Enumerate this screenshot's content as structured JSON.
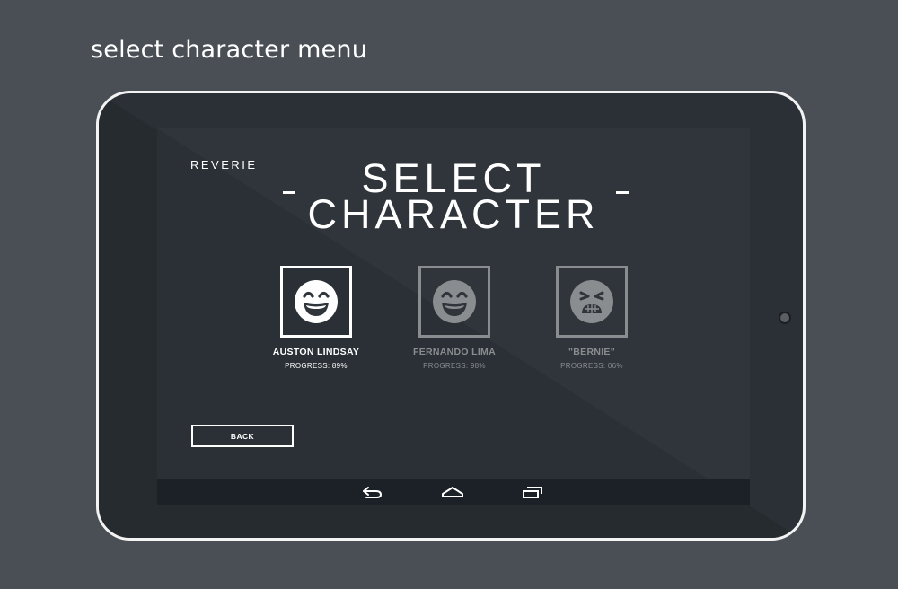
{
  "caption": "select character menu",
  "app": {
    "brand": "REVERIE",
    "title_line1": "SELECT",
    "title_line2": "CHARACTER"
  },
  "characters": [
    {
      "name": "AUSTON LINDSAY",
      "progress": "PROGRESS: 89%",
      "state": "selected",
      "icon": "grinning-face-icon"
    },
    {
      "name": "FERNANDO LIMA",
      "progress": "PROGRESS: 98%",
      "state": "inactive",
      "icon": "grinning-face-icon"
    },
    {
      "name": "\"BERNIE\"",
      "progress": "PROGRESS: 06%",
      "state": "inactive",
      "icon": "persevering-face-icon"
    }
  ],
  "back_button": {
    "label": "BACK"
  },
  "navbar": {
    "icons": [
      "back-arrow-icon",
      "home-icon",
      "recent-apps-icon"
    ]
  },
  "colors": {
    "page_background": "#4a4f55",
    "tablet_body": "#2b3036",
    "screen_background": "#2f353b",
    "navbar": "#1b2126",
    "active": "#ffffff",
    "inactive": "#8a8d90"
  }
}
